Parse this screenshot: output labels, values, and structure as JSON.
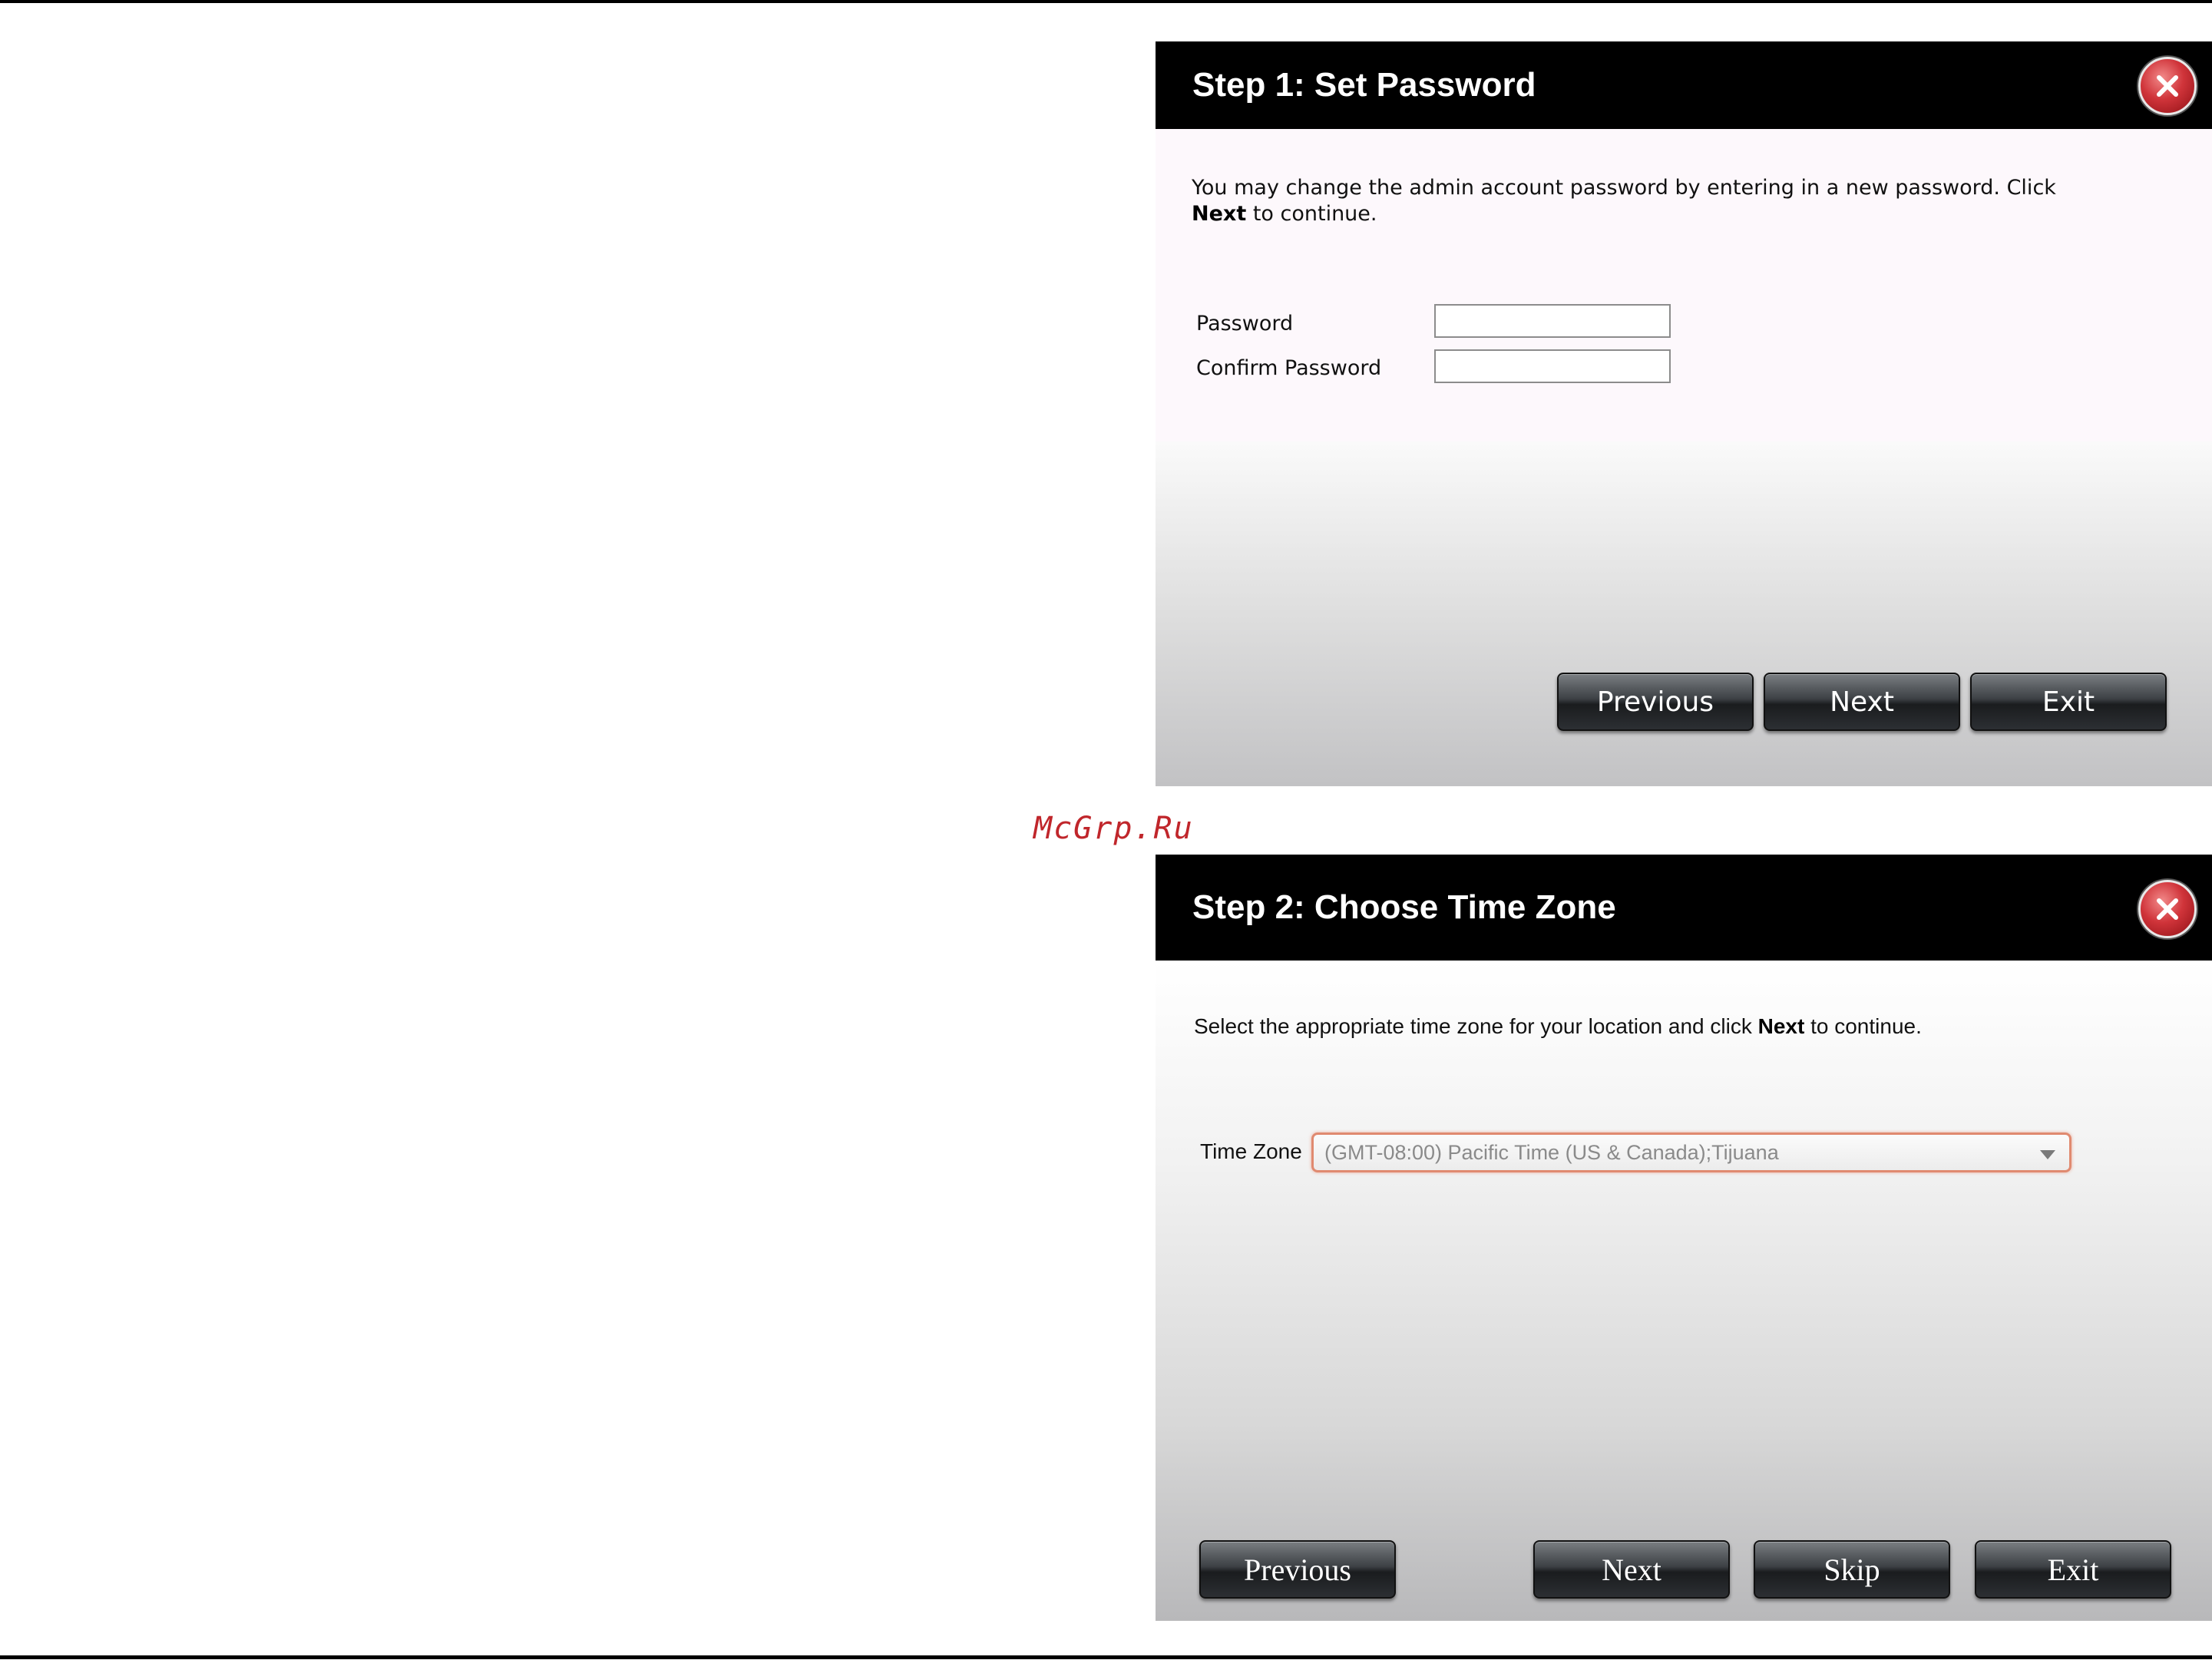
{
  "watermark": "McGrp.Ru",
  "step1": {
    "title": "Step 1: Set Password",
    "desc_prefix": "You may change the admin account password by entering in a new password. Click ",
    "desc_bold": "Next",
    "desc_suffix": " to continue.",
    "password_label": "Password",
    "password_value": "",
    "confirm_label": "Confirm Password",
    "confirm_value": "",
    "buttons": {
      "previous": "Previous",
      "next": "Next",
      "exit": "Exit"
    }
  },
  "step2": {
    "title": "Step 2: Choose Time Zone",
    "desc_prefix": "Select the appropriate time zone for your location and click ",
    "desc_bold": "Next",
    "desc_suffix": " to continue.",
    "timezone_label": "Time Zone",
    "timezone_value": "(GMT-08:00) Pacific Time (US & Canada);Tijuana",
    "buttons": {
      "previous": "Previous",
      "next": "Next",
      "skip": "Skip",
      "exit": "Exit"
    }
  },
  "icons": {
    "close": "close-icon",
    "dropdown": "chevron-down-icon"
  },
  "colors": {
    "titlebar": "#000000",
    "close_button": "#d0343a",
    "select_border": "#e08a70",
    "watermark": "#c0262b"
  }
}
